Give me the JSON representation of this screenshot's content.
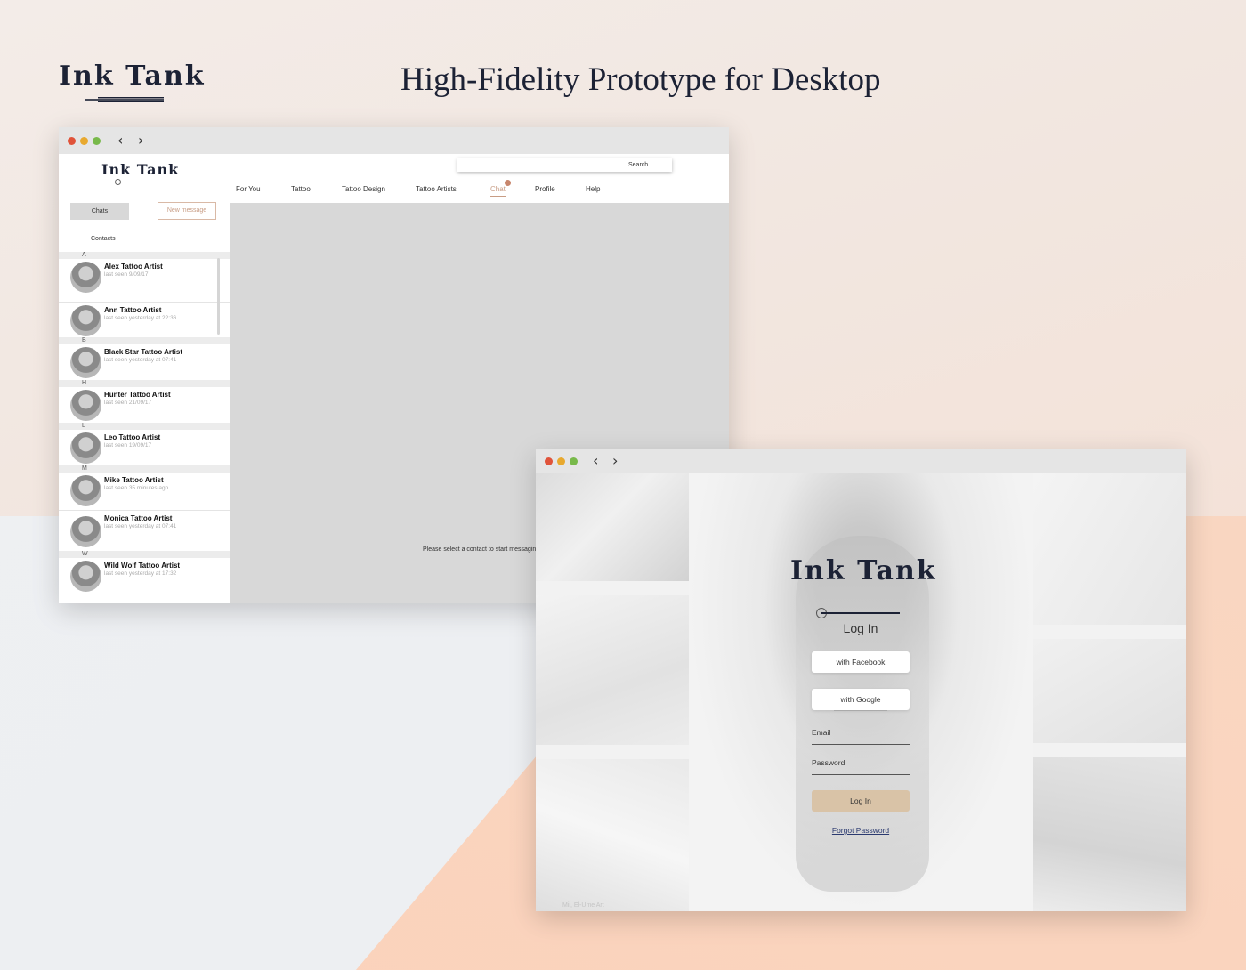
{
  "brand": {
    "name": "Ink Tank"
  },
  "page": {
    "title": "High-Fidelity Prototype for Desktop"
  },
  "chat_window": {
    "nav_back": "‹",
    "nav_forward": "›",
    "logo": "Ink Tank",
    "search_placeholder": "Search",
    "nav": [
      {
        "label": "For You"
      },
      {
        "label": "Tattoo"
      },
      {
        "label": "Tattoo Design"
      },
      {
        "label": "Tattoo Artists"
      },
      {
        "label": "Chat",
        "active": true
      },
      {
        "label": "Profile"
      },
      {
        "label": "Help"
      }
    ],
    "chats_button": "Chats",
    "new_message_button": "New message",
    "contacts_label": "Contacts",
    "letters": [
      "A",
      "B",
      "H",
      "L",
      "M",
      "W"
    ],
    "contacts": [
      {
        "name": "Alex Tattoo Artist",
        "seen": "last seen 9/09/17"
      },
      {
        "name": "Ann Tattoo Artist",
        "seen": "last seen yesterday at 22:36"
      },
      {
        "name": "Black Star Tattoo Artist",
        "seen": "last seen yesterday at 07:41"
      },
      {
        "name": "Hunter Tattoo Artist",
        "seen": "last seen 21/09/17"
      },
      {
        "name": "Leo Tattoo Artist",
        "seen": "last seen 19/09/17"
      },
      {
        "name": "Mike Tattoo Artist",
        "seen": "last seen 35 minutes ago"
      },
      {
        "name": "Monica Tattoo Artist",
        "seen": "last seen yesterday at 07:41"
      },
      {
        "name": "Wild Wolf Tattoo Artist",
        "seen": "last seen yesterday at 17:32"
      }
    ],
    "empty_hint": "Please select a contact to start messagin"
  },
  "login_window": {
    "nav_back": "‹",
    "nav_forward": "›",
    "logo": "Ink Tank",
    "heading": "Log In",
    "facebook_button": "with Facebook",
    "google_button": "with Google",
    "email_label": "Email",
    "password_label": "Password",
    "login_button": "Log In",
    "forgot_link": "Forgot Password",
    "watermark": "Mii, El-Ume Art"
  },
  "colors": {
    "brand_navy": "#1c2235",
    "accent_peach": "#c89d85",
    "login_button": "#d9c3a7",
    "dot_red": "#e0533a",
    "dot_yellow": "#e8a92f",
    "dot_green": "#78b94a"
  }
}
